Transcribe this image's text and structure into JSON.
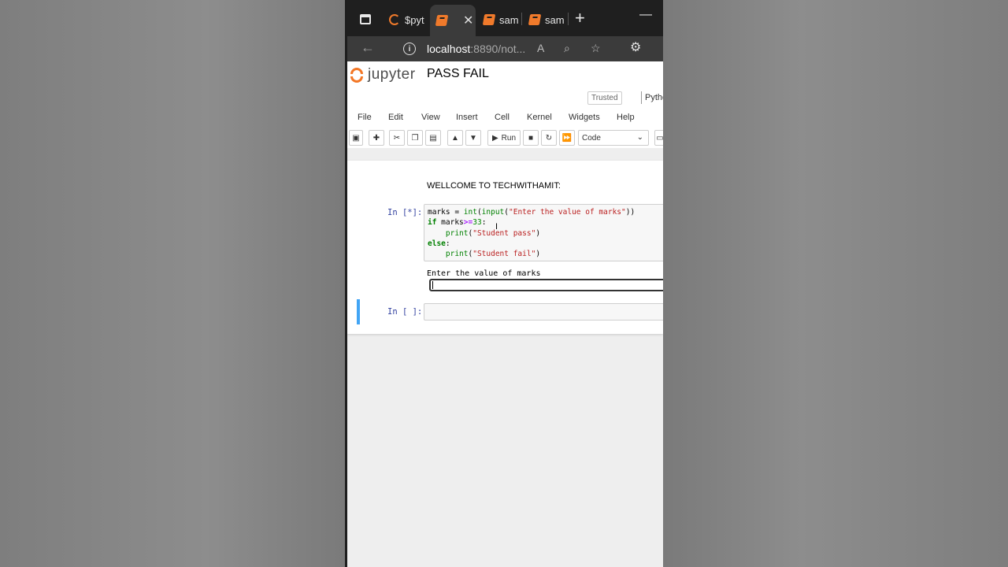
{
  "browser": {
    "tabs": [
      {
        "label": "$pyt",
        "active": false
      },
      {
        "label": "",
        "active": true
      },
      {
        "label": "sam",
        "active": false
      },
      {
        "label": "sam",
        "active": false
      }
    ],
    "url_host": "localhost",
    "url_rest": ":8890/not..."
  },
  "jupyter": {
    "logo_text": "jupyter",
    "notebook_title": "PASS FAIL",
    "trusted_label": "Trusted",
    "kernel_label": "Pytho",
    "menu": [
      "File",
      "Edit",
      "View",
      "Insert",
      "Cell",
      "Kernel",
      "Widgets",
      "Help"
    ],
    "run_label": "Run",
    "cell_type": "Code"
  },
  "notebook": {
    "markdown_text": "WELLCOME TO TECHWITHAMIT:",
    "cell1_prompt": "In [*]:",
    "cell1_code": {
      "l1_a": "marks = ",
      "l1_b": "int",
      "l1_c": "(",
      "l1_d": "input",
      "l1_e": "(",
      "l1_f": "\"Enter the value of marks\"",
      "l1_g": "))",
      "l2_a": "if",
      "l2_b": " marks",
      "l2_c": ">=",
      "l2_d": "33",
      "l2_e": ":",
      "l3_a": "    ",
      "l3_b": "print",
      "l3_c": "(",
      "l3_d": "\"Student pass\"",
      "l3_e": ")",
      "l4_a": "else",
      "l4_b": ":",
      "l5_a": "    ",
      "l5_b": "print",
      "l5_c": "(",
      "l5_d": "\"Student fail\"",
      "l5_e": ")"
    },
    "stdin_prompt": "Enter the value of marks",
    "cell2_prompt": "In [ ]:"
  },
  "colors": {
    "jupyter_orange": "#f37726",
    "prompt_blue": "#303f9f",
    "selected_cell": "#42a5f5"
  }
}
